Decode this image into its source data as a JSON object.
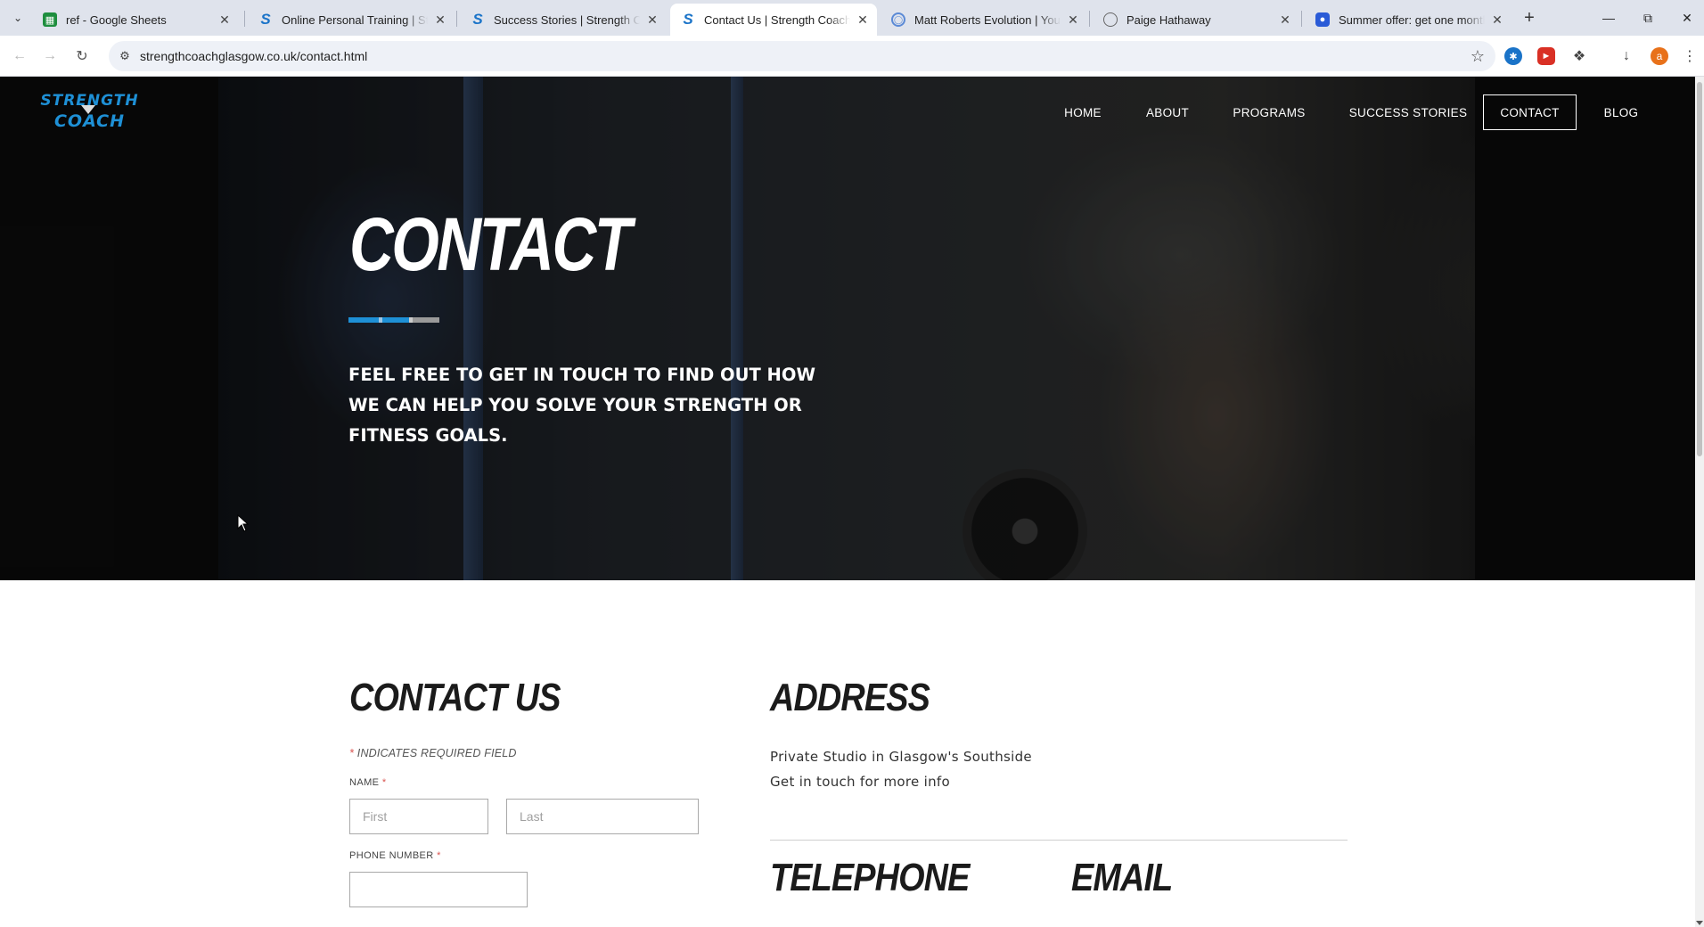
{
  "browser": {
    "tabs": [
      {
        "title": "ref - Google Sheets",
        "icon": "sheets-icon",
        "color": "#1e8e3e"
      },
      {
        "title": "Online Personal Training | Strength Coach",
        "icon": "site-s-icon",
        "color": "#1a73c8"
      },
      {
        "title": "Success Stories | Strength Coach",
        "icon": "site-s-icon",
        "color": "#1a73c8"
      },
      {
        "title": "Contact Us | Strength Coach Glasgow",
        "icon": "site-s-icon",
        "color": "#1a73c8"
      },
      {
        "title": "Matt Roberts Evolution | Young",
        "icon": "globe-icon",
        "color": "#5b8ad6"
      },
      {
        "title": "Paige Hathaway",
        "icon": "globe-icon",
        "color": "#666666"
      },
      {
        "title": "Summer offer: get one month free",
        "icon": "app-icon",
        "color": "#2a5bd7"
      }
    ],
    "active_tab_index": 3,
    "url": "strengthcoachglasgow.co.uk/contact.html",
    "profile_initial": "a"
  },
  "site": {
    "logo": {
      "line1": "STRENGTH",
      "line2": "COACH"
    },
    "nav": [
      "HOME",
      "ABOUT",
      "PROGRAMS",
      "SUCCESS STORIES",
      "CONTACT",
      "BLOG"
    ],
    "current_nav": "CONTACT",
    "colors": {
      "brand_blue": "#1e90d6",
      "accent_light": "#9a9a9a",
      "required": "#d9534f"
    }
  },
  "hero": {
    "title": "CONTACT",
    "text": "FEEL FREE TO GET IN TOUCH TO FIND OUT HOW WE CAN HELP YOU SOLVE YOUR STRENGTH OR FITNESS GOALS."
  },
  "contact_form": {
    "heading": "CONTACT US",
    "required_star": "*",
    "required_note": "INDICATES REQUIRED FIELD",
    "name_label": "NAME",
    "first_placeholder": "First",
    "last_placeholder": "Last",
    "phone_label": "PHONE NUMBER",
    "phone_value": ""
  },
  "address": {
    "heading": "ADDRESS",
    "line1": "Private Studio in Glasgow's Southside",
    "line2": "Get in touch for more info"
  },
  "telephone": {
    "heading": "TELEPHONE"
  },
  "email": {
    "heading": "EMAIL"
  }
}
